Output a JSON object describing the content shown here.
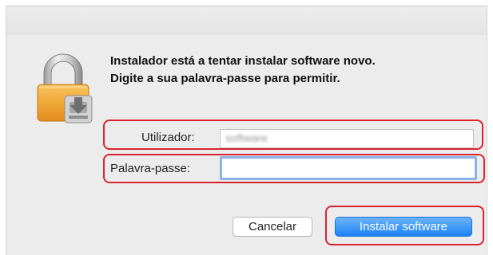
{
  "dialog": {
    "message_line1": "Instalador está a tentar instalar software novo.",
    "message_line2": "Digite a sua palavra-passe para permitir."
  },
  "fields": {
    "user_label": "Utilizador:",
    "user_value": "software",
    "password_label": "Palavra-passe:",
    "password_value": ""
  },
  "buttons": {
    "cancel_label": "Cancelar",
    "install_label": "Instalar software"
  },
  "icons": {
    "lock": "lock-icon"
  },
  "colors": {
    "highlight": "#d9232f",
    "primary_button": "#1a83f4",
    "focus_ring": "#8bb4e6"
  }
}
